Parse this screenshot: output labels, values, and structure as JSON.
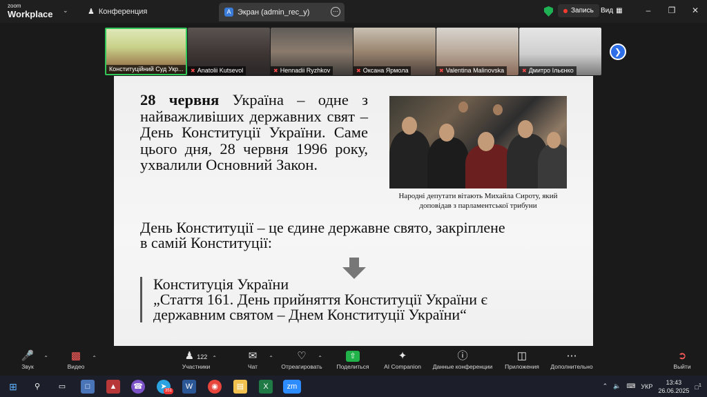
{
  "titlebar": {
    "brand_small": "zoom",
    "brand_big": "Workplace",
    "conference_label": "Конференция",
    "tab_label": "Экран (admin_rec_y)",
    "tab_badge": "A",
    "recording_label": "Запись",
    "view_label": "Вид"
  },
  "participants": [
    {
      "name": "Конституційний Суд Укр..."
    },
    {
      "name": "Anatolii Kutsevol"
    },
    {
      "name": "Hennadii Ryzhkov"
    },
    {
      "name": "Оксана Ярмола"
    },
    {
      "name": "Valentina Malinovska"
    },
    {
      "name": "Дмитро Ільєнко"
    }
  ],
  "slide": {
    "para1_bold": "28 червня",
    "para1_rest": " Україна – одне з найважливіших державних свят – День Конституції України. Саме цього дня, 28 червня 1996 року, ухвалили Основний Закон.",
    "caption": "Народні депутати вітають Михайла Сироту, який доповідав з парламентської трибуни",
    "para2": "День Конституції – це єдине державне свято, закріплене в самій Конституції:",
    "quote_title": "Конституція України",
    "quote_text": "„Стаття 161. День прийняття Конституції України є державним святом – Днем Конституції України“"
  },
  "toolbar": {
    "audio": "Звук",
    "video": "Видео",
    "participants": "Участники",
    "participants_count": "122",
    "chat": "Чат",
    "react": "Отреагировать",
    "share": "Поделиться",
    "ai": "AI Companion",
    "info": "Данные конференции",
    "apps": "Приложения",
    "more": "Дополнительно",
    "leave": "Выйти"
  },
  "taskbar": {
    "lang": "УКР",
    "time": "13:43",
    "date": "26.06.2025",
    "telegram_badge": "351",
    "notif_count": "1"
  },
  "colors": {
    "share_green": "#21b34a",
    "active_border": "#31c75a",
    "record_red": "#ff3b30",
    "shield_green": "#1fb254"
  }
}
